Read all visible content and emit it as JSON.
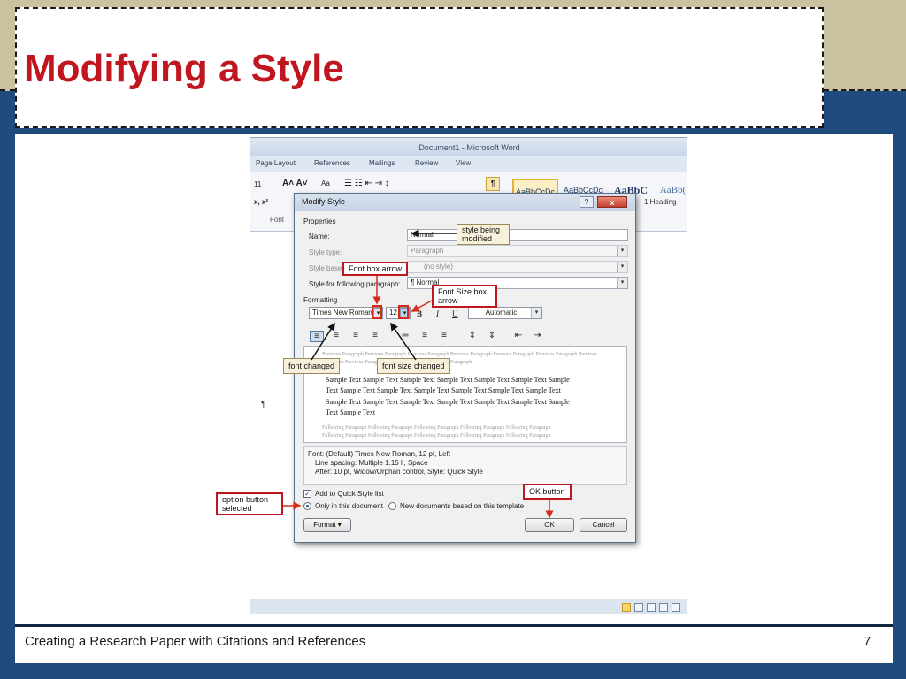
{
  "slide": {
    "title": "Modifying a Style",
    "footer": "Creating a Research Paper with Citations and References",
    "page_number": "7"
  },
  "word": {
    "window_title": "Document1 - Microsoft Word",
    "ribbon_tabs": [
      "Page Layout",
      "References",
      "Mailings",
      "Review",
      "View"
    ],
    "font_size": "11",
    "aa_label": "Aa",
    "font_group_label": "Font",
    "style_thumbs": [
      "AaBbCcDc",
      "AaBbCcDc",
      "AaBbC",
      "AaBb("
    ],
    "heading_label": "1   Heading",
    "paragraph_mark": "¶"
  },
  "dialog": {
    "title": "Modify Style",
    "help": "?",
    "close": "x",
    "properties_label": "Properties",
    "name_label": "Name:",
    "name_value": "Normal",
    "style_type_label": "Style type:",
    "style_type_value": "Paragraph",
    "style_based_label": "Style base",
    "style_based_value": "(no style)",
    "following_label": "Style for following paragraph:",
    "following_value": "¶ Normal",
    "formatting_label": "Formatting",
    "font_value": "Times New Roman",
    "size_value": "12",
    "bold": "B",
    "italic": "I",
    "underline": "U",
    "color_value": "Automatic",
    "preview_previous_1": "Previous Paragraph Previous Paragraph Previous Paragraph Previous Paragraph Previous Paragraph Previous Paragraph Previous",
    "preview_previous_2": "Paragraph Previous Paragraph Previous Paragraph Previous Paragraph",
    "sample_lines": [
      "Sample Text Sample Text Sample Text Sample Text Sample Text Sample Text Sample",
      "Text Sample Text Sample Text Sample Text Sample Text Sample Text Sample Text",
      "Sample Text Sample Text Sample Text Sample Text Sample Text Sample Text Sample",
      "Text Sample Text"
    ],
    "preview_following_1": "Following Paragraph Following Paragraph Following Paragraph Following Paragraph Following Paragraph",
    "preview_following_2": "Following Paragraph Following Paragraph Following Paragraph Following Paragraph Following Paragraph",
    "desc_1": "Font: (Default) Times New Roman, 12 pt, Left",
    "desc_2": "Line spacing:  Multiple 1.15 li, Space",
    "desc_3": "After:  10 pt, Widow/Orphan control, Style: Quick Style",
    "add_quick_style": "Add to Quick Style list",
    "only_this_doc": "Only in this document",
    "new_docs": "New documents based on this template",
    "format_btn": "Format ▾",
    "ok_btn": "OK",
    "cancel_btn": "Cancel"
  },
  "callouts": {
    "style_being_modified_1": "style being",
    "style_being_modified_2": "modified",
    "font_box_arrow": "Font box arrow",
    "font_size_box_arrow_1": "Font Size box",
    "font_size_box_arrow_2": "arrow",
    "font_changed": "font changed",
    "font_size_changed": "font size changed",
    "option_button_1": "option button",
    "option_button_2": "selected",
    "ok_button": "OK button"
  },
  "colors": {
    "title_red": "#c0161f",
    "slide_blue": "#1f4b7e",
    "callout_red": "#d42a1c"
  }
}
